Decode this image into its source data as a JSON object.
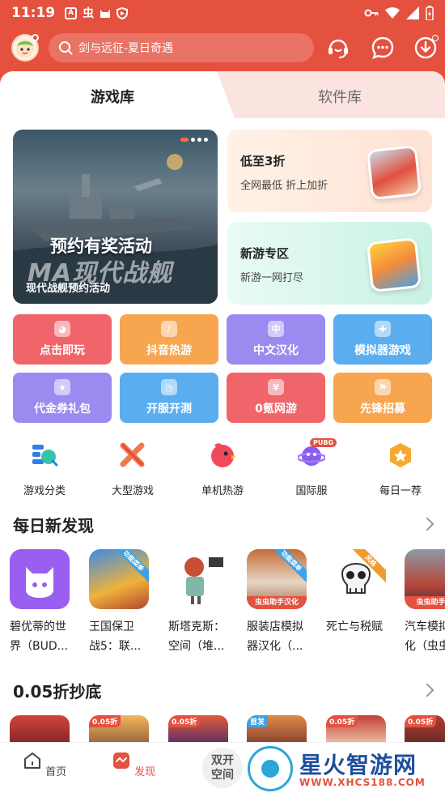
{
  "status_bar": {
    "time": "11:19",
    "left_icons": [
      "A",
      "虫",
      "cat",
      "shield"
    ],
    "right_icons": [
      "key-icon",
      "wifi-icon",
      "signal-icon",
      "battery-icon"
    ]
  },
  "header": {
    "search_placeholder": "剑与远征-夏日奇遇",
    "icons": [
      "service-icon",
      "message-icon",
      "download-icon"
    ]
  },
  "tabs": [
    {
      "label": "游戏库",
      "active": true
    },
    {
      "label": "软件库",
      "active": false
    }
  ],
  "banner": {
    "headline": "预约有奖活动",
    "logo_text": "MA现代战舰",
    "caption": "现代战舰预约活动"
  },
  "side_cards": [
    {
      "title": "低至3折",
      "subtitle": "全网最低 折上加折"
    },
    {
      "title": "新游专区",
      "subtitle": "新游一网打尽"
    }
  ],
  "quick_buttons": [
    {
      "label": "点击即玩",
      "color": "#f0656a"
    },
    {
      "label": "抖音热游",
      "color": "#f7a64f"
    },
    {
      "label": "中文汉化",
      "color": "#9b8af0"
    },
    {
      "label": "模拟器游戏",
      "color": "#5aaef0"
    },
    {
      "label": "代金券礼包",
      "color": "#9b8af0"
    },
    {
      "label": "开服开测",
      "color": "#5aaef0"
    },
    {
      "label": "0氪网游",
      "color": "#f0656a"
    },
    {
      "label": "先锋招募",
      "color": "#f7a64f"
    }
  ],
  "categories": [
    {
      "label": "游戏分类"
    },
    {
      "label": "大型游戏"
    },
    {
      "label": "单机热游"
    },
    {
      "label": "国际服",
      "badge": "PUBG"
    },
    {
      "label": "每日一荐"
    }
  ],
  "daily": {
    "title": "每日新发现",
    "games": [
      {
        "name": "碧优蒂的世\n界（BUD..."
      },
      {
        "name": "王国保卫\n战5：联...",
        "ribbon": "功能菜单"
      },
      {
        "name": "斯塔克斯：\n空间（堆..."
      },
      {
        "name": "服装店模拟\n器汉化（...",
        "ribbon": "功能菜单",
        "tag": "虫虫助手汉化"
      },
      {
        "name": "死亡与税赋",
        "ribbon": "风格"
      },
      {
        "name": "汽车模拟\n化（虫虫",
        "tag": "虫虫助手汉"
      }
    ]
  },
  "deals": {
    "title": "0.05折抄底",
    "tags": [
      "",
      "0.05折",
      "0.05折",
      "首发",
      "0.05折",
      "0.05折"
    ]
  },
  "bottom_nav": [
    {
      "label": "首页",
      "active": false
    },
    {
      "label": "发现",
      "active": true
    }
  ],
  "dual_space": "双开\n空间",
  "watermark": {
    "text": "星火智游网",
    "url": "WWW.XHCS188.COM"
  }
}
